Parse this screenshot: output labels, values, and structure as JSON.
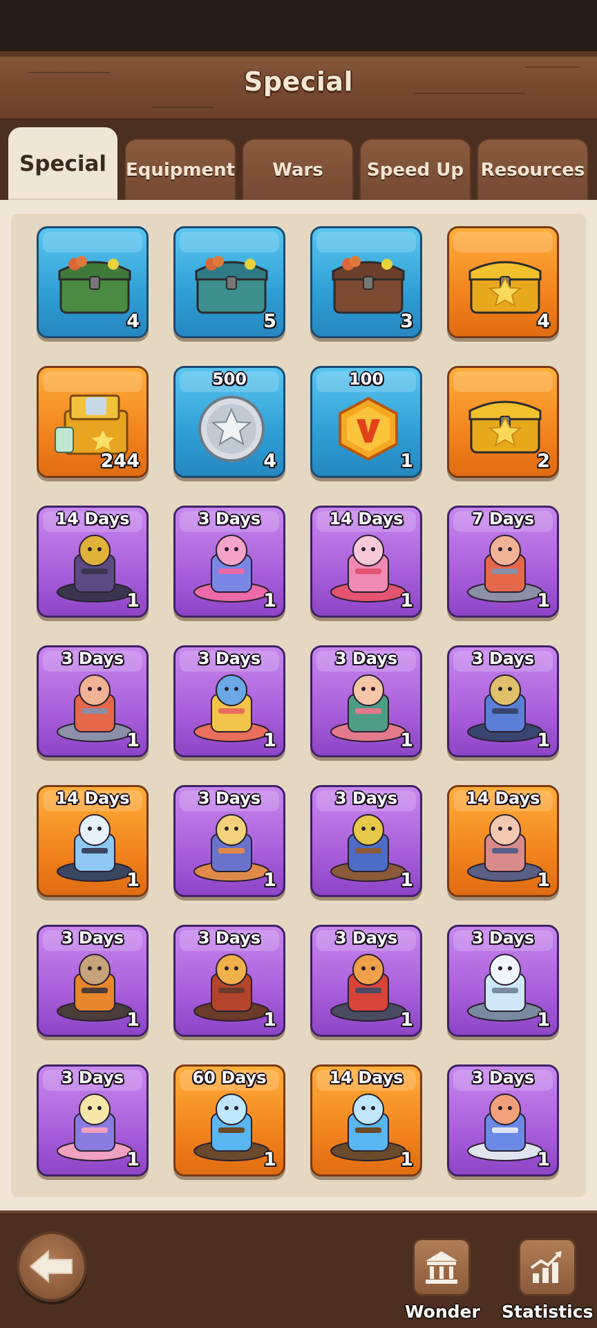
{
  "header": {
    "title": "Special"
  },
  "tabs": [
    {
      "label": "Special",
      "active": true
    },
    {
      "label": "Equipment",
      "active": false
    },
    {
      "label": "Wars",
      "active": false
    },
    {
      "label": "Speed Up",
      "active": false
    },
    {
      "label": "Resources",
      "active": false
    }
  ],
  "items": [
    {
      "icon": "green-chest-icon",
      "color": "blue",
      "label": "",
      "qty": "4"
    },
    {
      "icon": "teal-chest-icon",
      "color": "blue",
      "label": "",
      "qty": "5"
    },
    {
      "icon": "brown-chest-icon",
      "color": "blue",
      "label": "",
      "qty": "3"
    },
    {
      "icon": "gold-star-chest-icon",
      "color": "orange",
      "label": "",
      "qty": "4"
    },
    {
      "icon": "supply-crate-icon",
      "color": "orange",
      "label": "",
      "qty": "244"
    },
    {
      "icon": "silver-star-coin-icon",
      "color": "blue",
      "label": "500",
      "qty": "4"
    },
    {
      "icon": "vip-hexagon-icon",
      "color": "blue",
      "label": "100",
      "qty": "1"
    },
    {
      "icon": "gold-star-chest-icon",
      "color": "orange",
      "label": "",
      "qty": "2"
    },
    {
      "icon": "dark-fortress-skin-icon",
      "color": "purple",
      "label": "14 Days",
      "qty": "1"
    },
    {
      "icon": "bear-heart-skin-icon",
      "color": "purple",
      "label": "3 Days",
      "qty": "1"
    },
    {
      "icon": "pink-bunny-rose-skin-icon",
      "color": "purple",
      "label": "14 Days",
      "qty": "1"
    },
    {
      "icon": "crab-base-skin-icon",
      "color": "purple",
      "label": "7 Days",
      "qty": "1"
    },
    {
      "icon": "crab-base-skin-icon",
      "color": "purple",
      "label": "3 Days",
      "qty": "1"
    },
    {
      "icon": "easter-egg-skin-icon",
      "color": "purple",
      "label": "3 Days",
      "qty": "1"
    },
    {
      "icon": "sea-monster-skin-icon",
      "color": "purple",
      "label": "3 Days",
      "qty": "1"
    },
    {
      "icon": "observatory-skin-icon",
      "color": "purple",
      "label": "3 Days",
      "qty": "1"
    },
    {
      "icon": "ice-fortress-skin-icon",
      "color": "orange",
      "label": "14 Days",
      "qty": "1"
    },
    {
      "icon": "music-box-skin-icon",
      "color": "purple",
      "label": "3 Days",
      "qty": "1"
    },
    {
      "icon": "ship-cannon-skin-icon",
      "color": "purple",
      "label": "3 Days",
      "qty": "1"
    },
    {
      "icon": "pig-warrior-skin-icon",
      "color": "orange",
      "label": "14 Days",
      "qty": "1"
    },
    {
      "icon": "pumpkin-cat-skin-icon",
      "color": "purple",
      "label": "3 Days",
      "qty": "1"
    },
    {
      "icon": "turkey-skin-icon",
      "color": "purple",
      "label": "3 Days",
      "qty": "1"
    },
    {
      "icon": "red-mech-skin-icon",
      "color": "purple",
      "label": "3 Days",
      "qty": "1"
    },
    {
      "icon": "snow-cat-skin-icon",
      "color": "purple",
      "label": "3 Days",
      "qty": "1"
    },
    {
      "icon": "storybook-skin-icon",
      "color": "purple",
      "label": "3 Days",
      "qty": "1"
    },
    {
      "icon": "genie-boat-skin-icon",
      "color": "orange",
      "label": "60 Days",
      "qty": "1"
    },
    {
      "icon": "genie-boat-skin-icon",
      "color": "orange",
      "label": "14 Days",
      "qty": "1"
    },
    {
      "icon": "space-bunny-skin-icon",
      "color": "purple",
      "label": "3 Days",
      "qty": "1"
    }
  ],
  "bottom_nav": {
    "wonder_label": "Wonder",
    "statistics_label": "Statistics"
  },
  "colors": {
    "blue_tile": "#2e9fd6",
    "orange_tile": "#f2841e",
    "purple_tile": "#a95fdb",
    "wood": "#7a4d33",
    "panel": "#efe6d8"
  }
}
